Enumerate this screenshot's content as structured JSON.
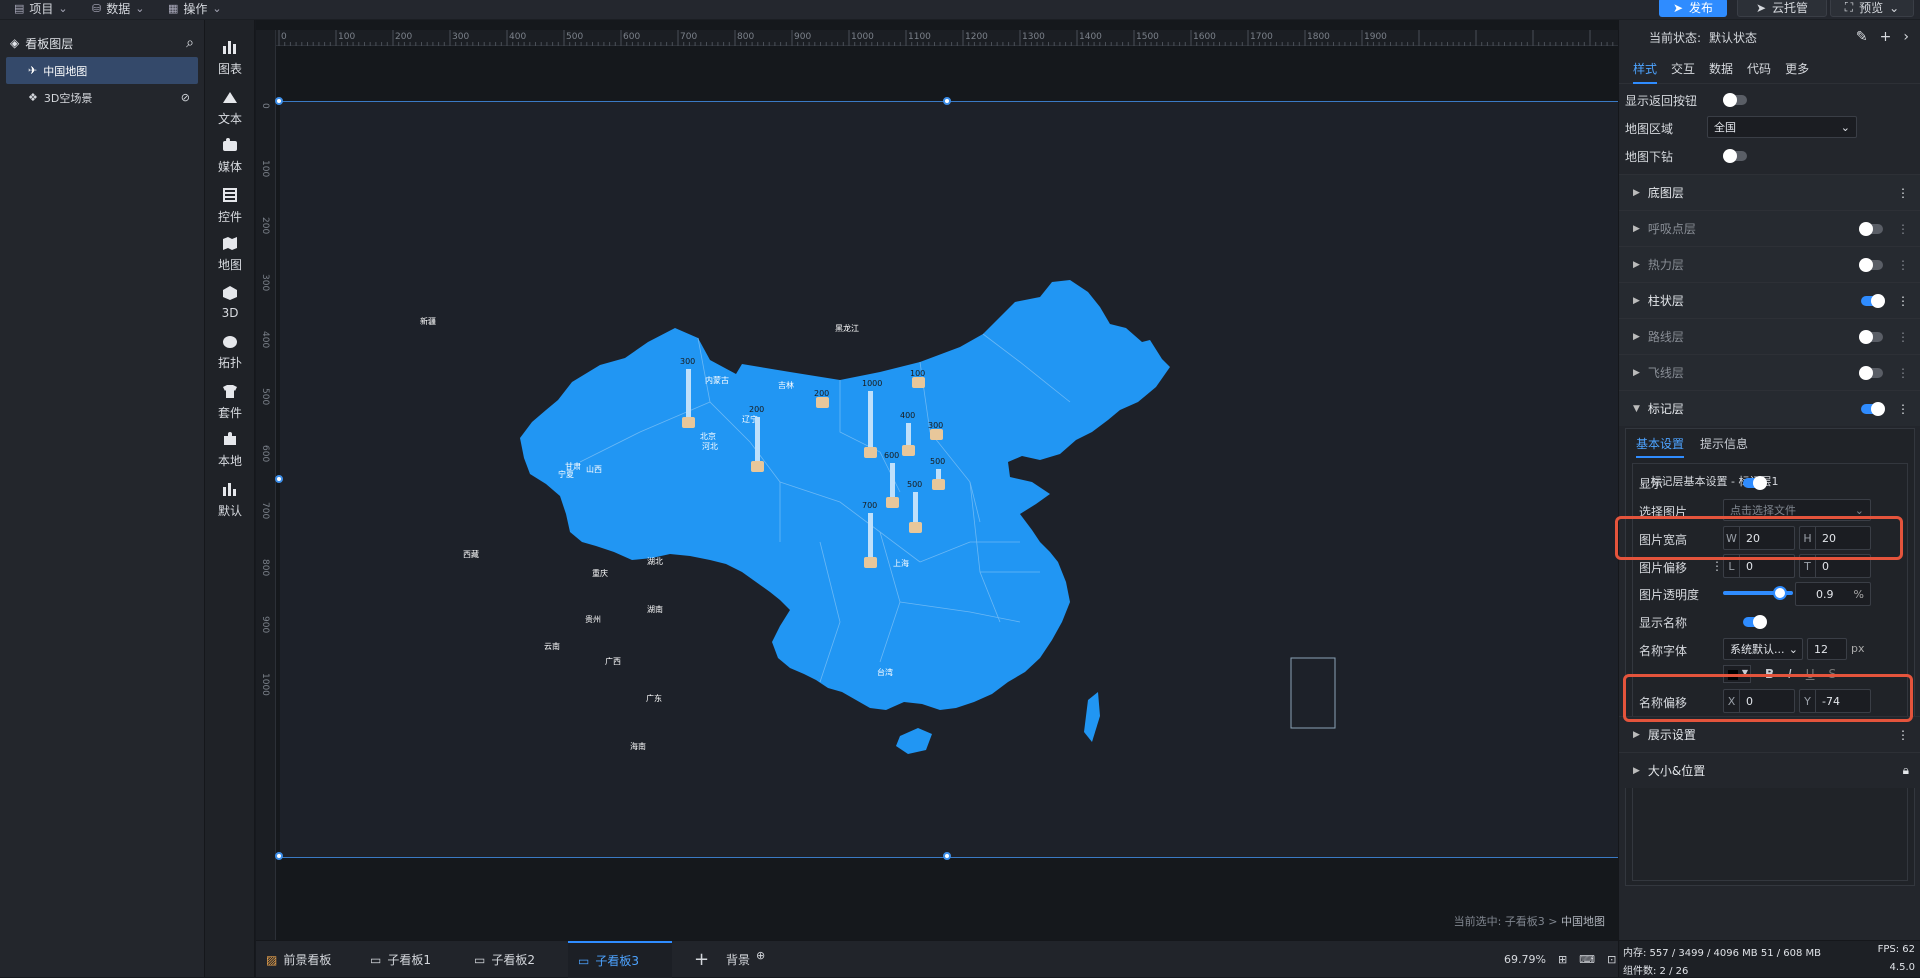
{
  "topbar": {
    "menus": [
      {
        "label": "项目"
      },
      {
        "label": "数据"
      },
      {
        "label": "操作"
      }
    ],
    "publish": "发布",
    "cloud": "云托管",
    "preview": "预览"
  },
  "layers": {
    "title": "看板图层",
    "items": [
      {
        "label": "中国地图"
      },
      {
        "label": "3D空场景"
      }
    ]
  },
  "icons": [
    {
      "label": "图表",
      "icon": "chart-icon"
    },
    {
      "label": "文本",
      "icon": "text-icon"
    },
    {
      "label": "媒体",
      "icon": "media-icon"
    },
    {
      "label": "控件",
      "icon": "widget-icon"
    },
    {
      "label": "地图",
      "icon": "map-icon"
    },
    {
      "label": "3D",
      "icon": "cube-icon"
    },
    {
      "label": "拓扑",
      "icon": "topology-icon"
    },
    {
      "label": "套件",
      "icon": "suite-icon"
    },
    {
      "label": "本地",
      "icon": "puzzle-icon"
    },
    {
      "label": "默认",
      "icon": "default-chart-icon"
    }
  ],
  "ruler": {
    "top": [
      "0",
      "100",
      "200",
      "300",
      "400",
      "500",
      "600",
      "700",
      "800",
      "900",
      "1000",
      "1100",
      "1200",
      "1300",
      "1400",
      "1500",
      "1600",
      "1700",
      "1800",
      "1900"
    ],
    "left": [
      "0",
      "100",
      "200",
      "300",
      "400",
      "500",
      "600",
      "700",
      "800",
      "900",
      "1000"
    ]
  },
  "map": {
    "provinces": [
      "新疆",
      "西藏",
      "甘肃",
      "内蒙古",
      "黑龙江",
      "吉林",
      "辽宁",
      "北京",
      "河北",
      "山西",
      "宁夏",
      "湖北",
      "重庆",
      "贵州",
      "湖南",
      "云南",
      "广西",
      "广东",
      "台湾",
      "海南",
      "上海"
    ],
    "bars": [
      {
        "label": "300"
      },
      {
        "label": "200"
      },
      {
        "label": "1000"
      },
      {
        "label": "100"
      },
      {
        "label": "400"
      },
      {
        "label": "300"
      },
      {
        "label": "600"
      },
      {
        "label": "500"
      },
      {
        "label": "700"
      },
      {
        "label": "200"
      },
      {
        "label": "500"
      }
    ]
  },
  "crumb": {
    "prefix": "当前选中: 子看板3 > ",
    "current": "中国地图"
  },
  "bottom": {
    "tabs": [
      {
        "label": "前景看板"
      },
      {
        "label": "子看板1"
      },
      {
        "label": "子看板2"
      },
      {
        "label": "子看板3"
      }
    ],
    "bg": "背景",
    "zoom": "69.79%",
    "memory": "内存:  557 / 3499 / 4096 MB  51 / 608 MB",
    "fps": "FPS:  62",
    "components": "组件数: 2 / 26",
    "version": "4.5.0"
  },
  "rpanel": {
    "state_label": "当前状态:",
    "state_value": "默认状态",
    "tabs": [
      {
        "label": "样式"
      },
      {
        "label": "交互"
      },
      {
        "label": "数据"
      },
      {
        "label": "代码"
      },
      {
        "label": "更多"
      }
    ],
    "show_back": "显示返回按钮",
    "region_label": "地图区域",
    "region_value": "全国",
    "drill": "地图下钻",
    "sections": [
      {
        "label": "底图层",
        "enabled": null
      },
      {
        "label": "呼吸点层",
        "enabled": false
      },
      {
        "label": "热力层",
        "enabled": false
      },
      {
        "label": "柱状层",
        "enabled": true
      },
      {
        "label": "路线层",
        "enabled": false
      },
      {
        "label": "飞线层",
        "enabled": false
      },
      {
        "label": "标记层",
        "enabled": true
      }
    ],
    "subtabs": [
      {
        "label": "基本设置"
      },
      {
        "label": "提示信息"
      }
    ],
    "group_title": "标记层基本设置 - 标记层1",
    "show": "显示",
    "pick_image": "选择图片",
    "pick_placeholder": "点击选择文件",
    "img_size": "图片宽高",
    "w": "20",
    "h": "20",
    "img_offset": "图片偏移",
    "l": "0",
    "t": "0",
    "opacity_label": "图片透明度",
    "opacity": "0.9",
    "opacity_unit": "%",
    "show_name": "显示名称",
    "font_label": "名称字体",
    "font_value": "系统默认...",
    "font_size": "12",
    "font_unit": "px",
    "name_offset": "名称偏移",
    "x": "0",
    "y": "-74",
    "display": "展示设置",
    "size_pos": "大小&位置"
  }
}
